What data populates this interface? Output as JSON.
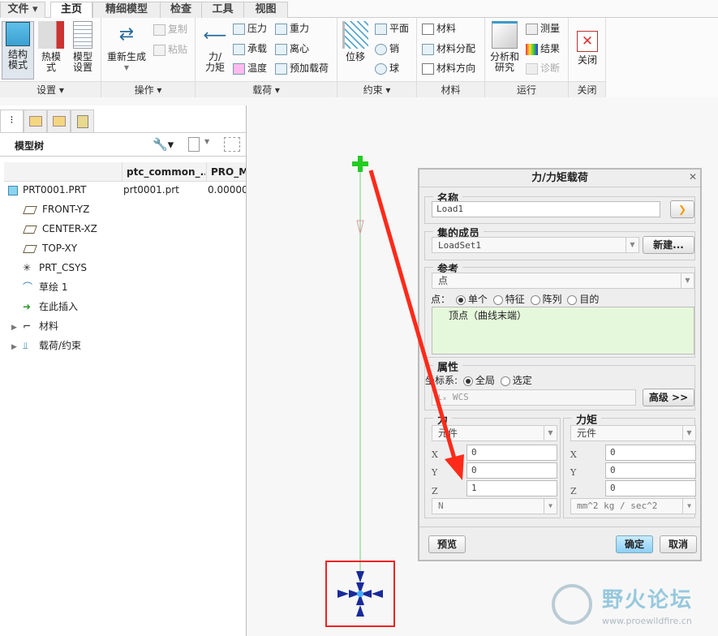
{
  "menu_tabs": [
    "文件 ▾",
    "主页",
    "精细模型",
    "检查",
    "工具",
    "视图"
  ],
  "ribbon": {
    "setup": {
      "label": "设置 ▾",
      "items": [
        "结构\n模式",
        "热模\n式",
        "模型\n设置"
      ]
    },
    "operations": {
      "label": "操作 ▾",
      "regenerate": "重新生成",
      "copy": "复制",
      "paste": "粘贴"
    },
    "loads": {
      "label": "载荷 ▾",
      "force_moment": "力/\n力矩",
      "pressure": "压力",
      "gravity": "重力",
      "bearing": "承载",
      "centrifugal": "离心",
      "temperature": "温度",
      "preload": "预加载荷"
    },
    "constraints": {
      "label": "约束 ▾",
      "displacement": "位移",
      "plane": "平面",
      "pin": "销",
      "ball": "球"
    },
    "materials": {
      "label": "材料",
      "material": "材料",
      "assignment": "材料分配",
      "orientation": "材料方向"
    },
    "run": {
      "label": "运行",
      "analyses": "分析和\n研究",
      "measure": "测量",
      "results": "结果",
      "diagnostics": "诊断"
    },
    "close": {
      "label": "关闭",
      "button": "关闭"
    }
  },
  "model_tree": {
    "title": "模型树",
    "columns": [
      "ptc_common_...",
      "PRO_M"
    ],
    "root": {
      "name": "PRT0001.PRT",
      "col1": "prt0001.prt",
      "col2": "0.00000"
    },
    "items": [
      "FRONT-YZ",
      "CENTER-XZ",
      "TOP-XY",
      "PRT_CSYS",
      "草绘 1",
      "在此插入",
      "材料",
      "载荷/约束"
    ]
  },
  "dialog": {
    "title": "力/力矩载荷",
    "name_label": "名称",
    "name_value": "Load1",
    "set_label": "集的成员",
    "set_value": "LoadSet1",
    "new_button": "新建...",
    "ref_label": "参考",
    "ref_value": "点",
    "point_label": "点：",
    "point_options": [
      "单个",
      "特征",
      "阵列",
      "目的"
    ],
    "point_selected": 0,
    "ref_item": "顶点（曲线末端）",
    "props_label": "属性",
    "csys_label": "坐标系:",
    "csys_options": [
      "全局",
      "选定"
    ],
    "csys_selected": 0,
    "csys_value": "WCS",
    "advanced_button": "高级 >>",
    "force": {
      "label": "力",
      "type": "元件",
      "x": "0",
      "y": "0",
      "z": "1",
      "unit": "N"
    },
    "moment": {
      "label": "力矩",
      "type": "元件",
      "x": "0",
      "y": "0",
      "z": "0",
      "unit": "mm^2 kg / sec^2"
    },
    "axis_labels": [
      "X",
      "Y",
      "Z"
    ],
    "preview": "预览",
    "ok": "确定",
    "cancel": "取消"
  },
  "watermark": {
    "title": "野火论坛",
    "url": "www.proewildfire.cn"
  },
  "colors": {
    "accent_red": "#ff2a1a",
    "line_green": "#66bb66",
    "ok_blue": "#a8d8f8"
  }
}
